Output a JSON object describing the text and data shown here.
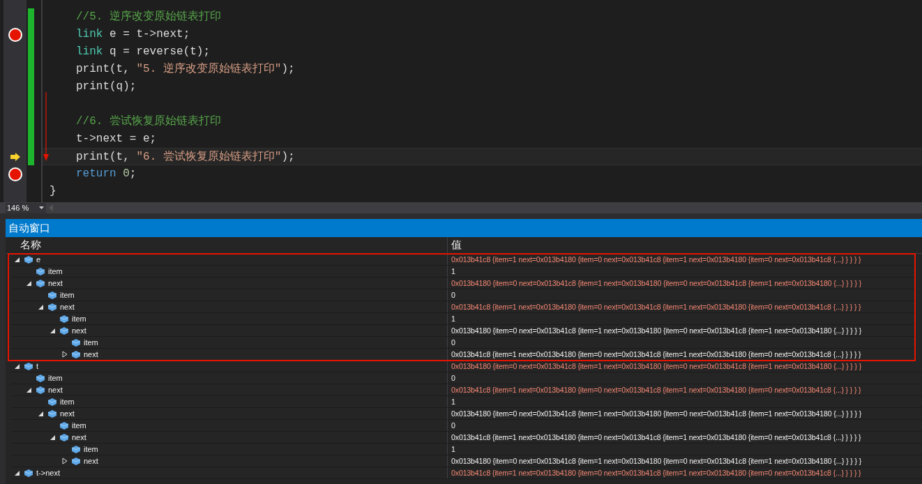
{
  "editor": {
    "lines": [
      {
        "indented": true,
        "modified": true,
        "breakpoint": false,
        "current": false,
        "tokens": [
          {
            "kind": "comment",
            "text": "//5. 逆序改变原始链表打印"
          }
        ]
      },
      {
        "indented": true,
        "modified": true,
        "breakpoint": true,
        "current": false,
        "tokens": [
          {
            "kind": "type",
            "text": "link"
          },
          {
            "kind": "plain",
            "text": " e = t->next;"
          }
        ]
      },
      {
        "indented": true,
        "modified": true,
        "breakpoint": false,
        "current": false,
        "tokens": [
          {
            "kind": "type",
            "text": "link"
          },
          {
            "kind": "plain",
            "text": " q = reverse(t);"
          }
        ]
      },
      {
        "indented": true,
        "modified": true,
        "breakpoint": false,
        "current": false,
        "tokens": [
          {
            "kind": "plain",
            "text": "print(t, "
          },
          {
            "kind": "string",
            "text": "\"5. 逆序改变原始链表打印\""
          },
          {
            "kind": "plain",
            "text": ");"
          }
        ]
      },
      {
        "indented": true,
        "modified": true,
        "breakpoint": false,
        "current": false,
        "tokens": [
          {
            "kind": "plain",
            "text": "print(q);"
          }
        ]
      },
      {
        "indented": true,
        "modified": true,
        "breakpoint": false,
        "current": false
      },
      {
        "indented": true,
        "modified": true,
        "breakpoint": false,
        "current": false,
        "tokens": [
          {
            "kind": "comment",
            "text": "//6. 尝试恢复原始链表打印"
          }
        ]
      },
      {
        "indented": true,
        "modified": true,
        "breakpoint": false,
        "current": false,
        "tokens": [
          {
            "kind": "plain",
            "text": "t->next = e;"
          }
        ]
      },
      {
        "indented": true,
        "modified": true,
        "breakpoint": false,
        "current": true,
        "tokens": [
          {
            "kind": "plain",
            "text": "print(t, "
          },
          {
            "kind": "string",
            "text": "\"6. 尝试恢复原始链表打印\""
          },
          {
            "kind": "plain",
            "text": ");"
          }
        ]
      },
      {
        "indented": true,
        "modified": false,
        "breakpoint": true,
        "current": false,
        "tokens": [
          {
            "kind": "keyword",
            "text": "return"
          },
          {
            "kind": "number",
            "text": "0"
          },
          {
            "kind": "plain",
            "text": ";"
          }
        ]
      },
      {
        "indented": false,
        "modified": false,
        "breakpoint": false,
        "current": false,
        "tokens": [
          {
            "kind": "plain",
            "text": "}"
          }
        ]
      }
    ]
  },
  "zoom": {
    "value": "146 %"
  },
  "autos": {
    "title": "自动窗口",
    "columns": [
      "名称",
      "值"
    ],
    "rows": [
      {
        "name": "e",
        "value": "0x013b41c8 {item=1 next=0x013b4180 {item=0 next=0x013b41c8 {item=1 next=0x013b4180 {item=0 next=0x013b41c8 {...} } } } }",
        "changed": true,
        "expanded": true,
        "highlighted": true,
        "children": [
          {
            "name": "item",
            "value": "1",
            "changed": false
          },
          {
            "name": "next",
            "value": "0x013b4180 {item=0 next=0x013b41c8 {item=1 next=0x013b4180 {item=0 next=0x013b41c8 {item=1 next=0x013b4180 {...} } } } }",
            "changed": true,
            "expanded": true,
            "children": [
              {
                "name": "item",
                "value": "0",
                "changed": false
              },
              {
                "name": "next",
                "value": "0x013b41c8 {item=1 next=0x013b4180 {item=0 next=0x013b41c8 {item=1 next=0x013b4180 {item=0 next=0x013b41c8 {...} } } } }",
                "changed": true,
                "expanded": true,
                "children": [
                  {
                    "name": "item",
                    "value": "1",
                    "changed": false
                  },
                  {
                    "name": "next",
                    "value": "0x013b4180 {item=0 next=0x013b41c8 {item=1 next=0x013b4180 {item=0 next=0x013b41c8 {item=1 next=0x013b4180 {...} } } } }",
                    "changed": false,
                    "expanded": true,
                    "children": [
                      {
                        "name": "item",
                        "value": "0",
                        "changed": false
                      },
                      {
                        "name": "next",
                        "value": "0x013b41c8 {item=1 next=0x013b4180 {item=0 next=0x013b41c8 {item=1 next=0x013b4180 {item=0 next=0x013b41c8 {...} } } } }",
                        "changed": false,
                        "expanded": false
                      }
                    ]
                  }
                ]
              }
            ]
          }
        ]
      },
      {
        "name": "t",
        "value": "0x013b4180 {item=0 next=0x013b41c8 {item=1 next=0x013b4180 {item=0 next=0x013b41c8 {item=1 next=0x013b4180 {...} } } } }",
        "changed": true,
        "expanded": true,
        "highlighted": false,
        "children": [
          {
            "name": "item",
            "value": "0",
            "changed": false
          },
          {
            "name": "next",
            "value": "0x013b41c8 {item=1 next=0x013b4180 {item=0 next=0x013b41c8 {item=1 next=0x013b4180 {item=0 next=0x013b41c8 {...} } } } }",
            "changed": true,
            "expanded": true,
            "children": [
              {
                "name": "item",
                "value": "1",
                "changed": false
              },
              {
                "name": "next",
                "value": "0x013b4180 {item=0 next=0x013b41c8 {item=1 next=0x013b4180 {item=0 next=0x013b41c8 {item=1 next=0x013b4180 {...} } } } }",
                "changed": false,
                "expanded": true,
                "children": [
                  {
                    "name": "item",
                    "value": "0",
                    "changed": false
                  },
                  {
                    "name": "next",
                    "value": "0x013b41c8 {item=1 next=0x013b4180 {item=0 next=0x013b41c8 {item=1 next=0x013b4180 {item=0 next=0x013b41c8 {...} } } } }",
                    "changed": false,
                    "expanded": true,
                    "children": [
                      {
                        "name": "item",
                        "value": "1",
                        "changed": false
                      },
                      {
                        "name": "next",
                        "value": "0x013b4180 {item=0 next=0x013b41c8 {item=1 next=0x013b4180 {item=0 next=0x013b41c8 {item=1 next=0x013b4180 {...} } } } }",
                        "changed": false,
                        "expanded": false
                      }
                    ]
                  }
                ]
              }
            ]
          }
        ]
      },
      {
        "name": "t->next",
        "value": "0x013b41c8 {item=1 next=0x013b4180 {item=0 next=0x013b41c8 {item=1 next=0x013b4180 {item=0 next=0x013b41c8 {...} } } } }",
        "changed": true,
        "expanded": true,
        "highlighted": false
      }
    ]
  }
}
